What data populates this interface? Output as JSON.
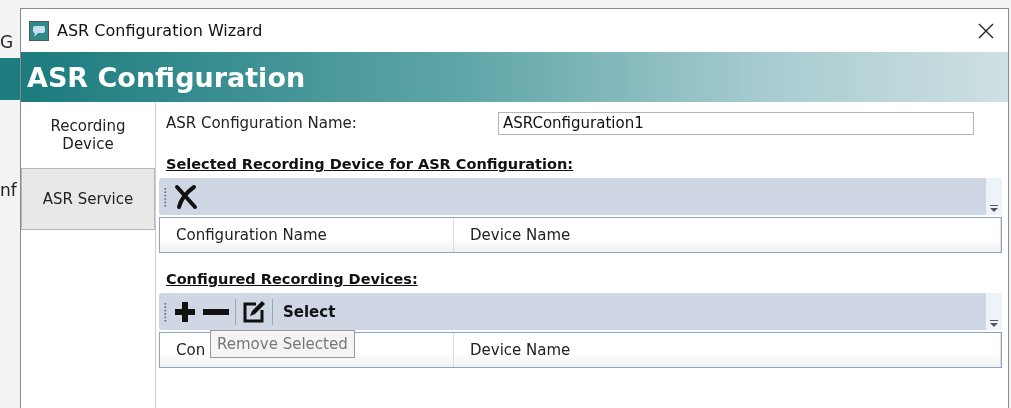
{
  "background": {
    "texts": [
      "G",
      "nf"
    ]
  },
  "window": {
    "title": "ASR Configuration Wizard"
  },
  "banner": {
    "title": "ASR Configuration"
  },
  "steps": [
    {
      "label": "Recording\nDevice",
      "selected": true
    },
    {
      "label": "ASR Service",
      "selected": false
    }
  ],
  "name_field": {
    "label": "ASR Configuration Name:",
    "value": "ASRConfiguration1"
  },
  "sections": [
    {
      "heading": "Selected Recording Device for ASR Configuration:",
      "toolbar": [
        {
          "kind": "clear"
        }
      ],
      "columns": [
        "Configuration Name",
        "Device Name"
      ]
    },
    {
      "heading": "Configured Recording Devices:",
      "toolbar": [
        {
          "kind": "add"
        },
        {
          "kind": "remove"
        },
        {
          "kind": "separator"
        },
        {
          "kind": "edit"
        },
        {
          "kind": "separator"
        },
        {
          "kind": "text",
          "label": "Select"
        }
      ],
      "columns": [
        "Con",
        "Device Name"
      ],
      "tooltip": "Remove Selected"
    }
  ]
}
